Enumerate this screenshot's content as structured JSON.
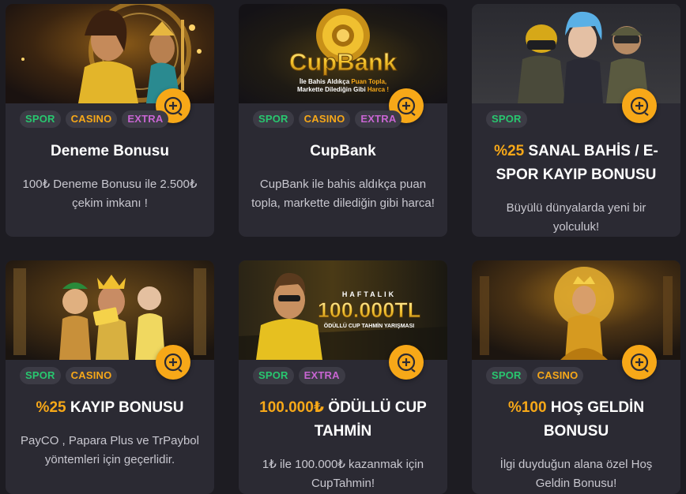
{
  "cards": [
    {
      "tags": [
        "SPOR",
        "CASINO",
        "EXTRA"
      ],
      "title_highlight": "",
      "title": "Deneme Bonusu",
      "description": "100₺ Deneme Bonusu ile 2.500₺ çekim imkanı !"
    },
    {
      "banner": {
        "logo": "CupBank",
        "line1_pre": "İle Bahis Aldıkça ",
        "line1_hl": "Puan Topla,",
        "line2_pre": "Markette Dilediğin Gibi ",
        "line2_hl": "Harca !"
      },
      "tags": [
        "SPOR",
        "CASINO",
        "EXTRA"
      ],
      "title_highlight": "",
      "title": "CupBank",
      "description": "CupBank ile bahis aldıkça puan topla, markette dilediğin gibi harca!"
    },
    {
      "tags": [
        "SPOR"
      ],
      "title_highlight": "%25",
      "title": " SANAL BAHİS / E-SPOR KAYIP BONUSU",
      "description": "Büyülü dünyalarda yeni bir yolculuk!"
    },
    {
      "tags": [
        "SPOR",
        "CASINO"
      ],
      "title_highlight": "%25",
      "title": " KAYIP BONUSU",
      "description": "PayCO , Papara Plus ve TrPaybol yöntemleri için geçerlidir."
    },
    {
      "banner": {
        "kicker": "HAFTALIK",
        "amount": "100.000TL",
        "subtitle": "ÖDÜLLÜ CUP TAHMİN YARIŞMASI"
      },
      "tags": [
        "SPOR",
        "EXTRA"
      ],
      "title_highlight": "100.000₺",
      "title": " ÖDÜLLÜ CUP TAHMİN",
      "description": "1₺ ile 100.000₺ kazanmak için CupTahmin!"
    },
    {
      "tags": [
        "SPOR",
        "CASINO"
      ],
      "title_highlight": "%100",
      "title": " HOŞ GELDİN BONUSU",
      "description": "İlgi duyduğun alana özel Hoş Geldin Bonusu!"
    }
  ],
  "colors": {
    "accent": "#f7a818",
    "spor": "#28c76f",
    "casino": "#f7a818",
    "extra": "#c865d2",
    "card_bg": "#2b2a33",
    "page_bg": "#1d1c22"
  },
  "icons": {
    "add_button": "plus-circle-icon"
  }
}
